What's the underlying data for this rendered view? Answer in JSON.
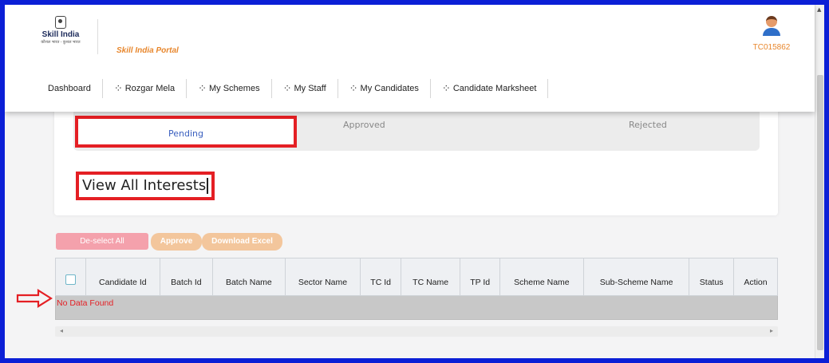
{
  "header": {
    "logo": {
      "brand": "Skill India",
      "tagline": "कौशल भारत - कुशल भारत"
    },
    "portal_title": "Skill India Portal",
    "user_id": "TC015862"
  },
  "nav": {
    "items": [
      {
        "label": "Dashboard",
        "icon": "none"
      },
      {
        "label": "Rozgar Mela",
        "icon": "network-icon"
      },
      {
        "label": "My Schemes",
        "icon": "network-icon"
      },
      {
        "label": "My Staff",
        "icon": "network-icon"
      },
      {
        "label": "My Candidates",
        "icon": "network-icon"
      },
      {
        "label": "Candidate Marksheet",
        "icon": "network-icon"
      }
    ]
  },
  "tabs": {
    "pending": "Pending",
    "approved": "Approved",
    "rejected": "Rejected",
    "active": "pending"
  },
  "page_title": "View All Interests",
  "actions": {
    "deselect_all": "De-select All",
    "approve": "Approve",
    "download_excel": "Download Excel"
  },
  "table": {
    "columns": [
      "",
      "Candidate Id",
      "Batch Id",
      "Batch Name",
      "Sector Name",
      "TC Id",
      "TC Name",
      "TP Id",
      "Scheme Name",
      "Sub-Scheme Name",
      "Status",
      "Action"
    ],
    "empty_message": "No Data Found"
  },
  "colors": {
    "accent_orange": "#e8872d",
    "highlight_red": "#e41f24",
    "frame_blue": "#0b1fd6"
  }
}
